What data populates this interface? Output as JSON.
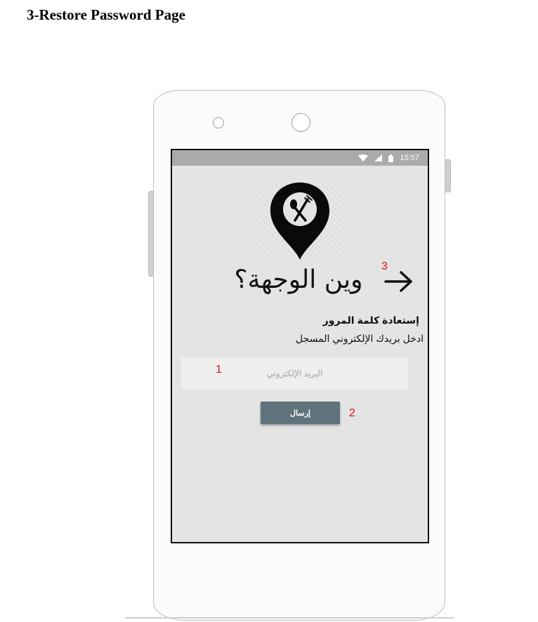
{
  "page": {
    "heading": "3-Restore Password Page"
  },
  "status_bar": {
    "time": "15:57",
    "icons": [
      "wifi-icon",
      "signal-icon",
      "battery-icon"
    ]
  },
  "app": {
    "logo_icon": "map-pin-fork-spoon-icon",
    "title": "وين الوجهة؟",
    "back_icon": "arrow-right-icon"
  },
  "restore_form": {
    "section_title": "إستعادة كلمة المرور",
    "instruction": "ادخل بريدك الإلكتروني المسجل",
    "email_value": "",
    "email_placeholder": "البريد الإلكتروني",
    "submit_label": "إرسال"
  },
  "callouts": {
    "email": "1",
    "submit": "2",
    "back": "3"
  },
  "colors": {
    "screen_bg": "#e4e4e4",
    "status_bar": "#aaaaaa",
    "button": "#5f737c",
    "callout": "#dd1111"
  }
}
